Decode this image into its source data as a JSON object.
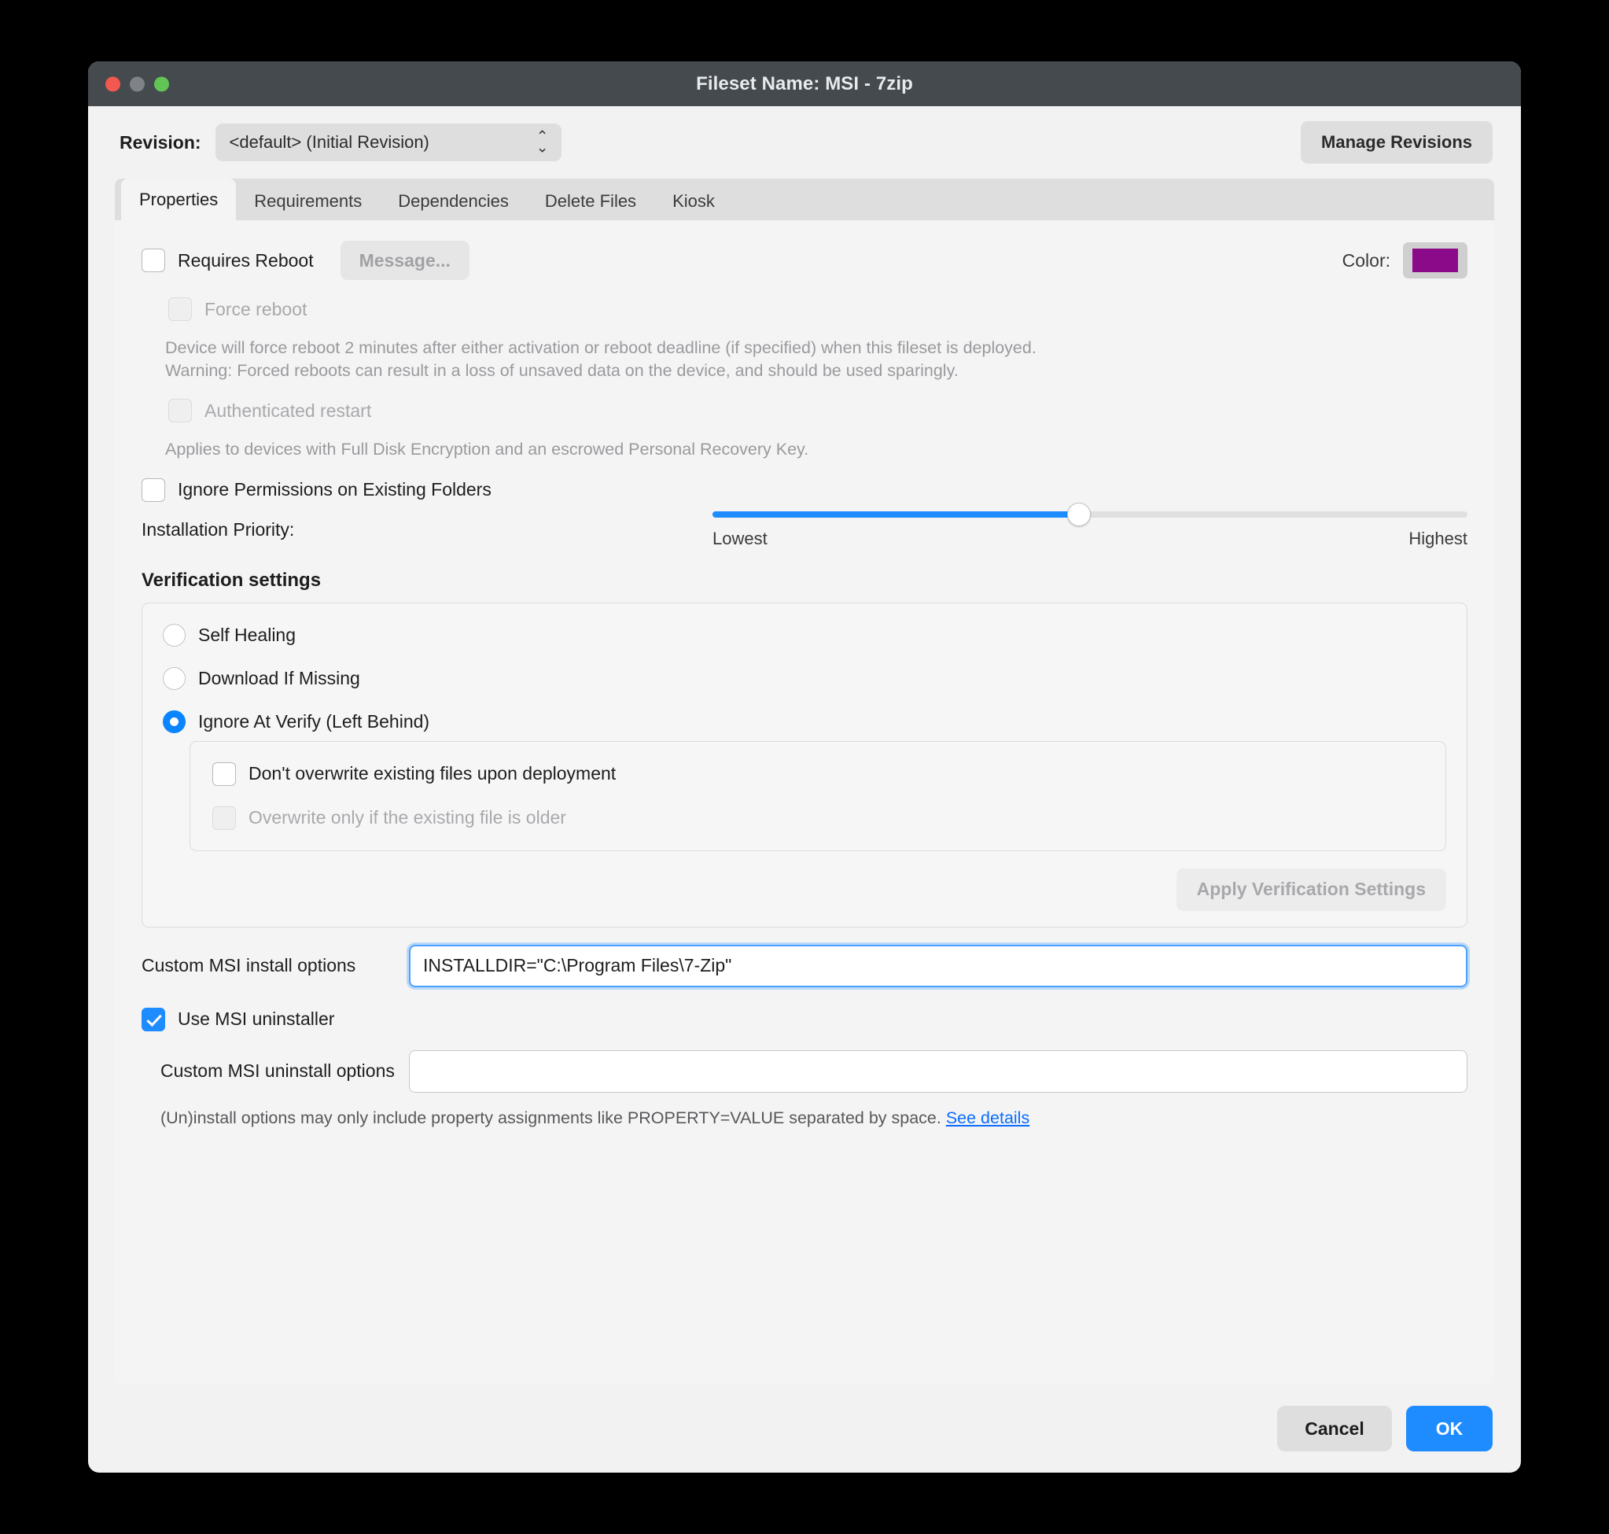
{
  "window": {
    "title": "Fileset Name: MSI - 7zip",
    "traffic_lights": [
      "close",
      "minimize",
      "zoom"
    ]
  },
  "revision": {
    "label": "Revision:",
    "selected": "<default> (Initial Revision)",
    "manage_button": "Manage Revisions"
  },
  "tabs": [
    {
      "label": "Properties",
      "active": true
    },
    {
      "label": "Requirements",
      "active": false
    },
    {
      "label": "Dependencies",
      "active": false
    },
    {
      "label": "Delete Files",
      "active": false
    },
    {
      "label": "Kiosk",
      "active": false
    }
  ],
  "properties": {
    "requires_reboot": {
      "label": "Requires Reboot",
      "checked": false,
      "message_button": "Message..."
    },
    "color": {
      "caption": "Color:",
      "value": "#8a0a8a"
    },
    "force_reboot": {
      "label": "Force reboot",
      "checked": false,
      "enabled": false
    },
    "force_reboot_hint_line1": "Device will force reboot 2 minutes after either activation or reboot deadline (if specified) when this fileset is deployed.",
    "force_reboot_hint_line2": "Warning: Forced reboots can result in a loss of unsaved data on the device, and should be used sparingly.",
    "authenticated_restart": {
      "label": "Authenticated restart",
      "checked": false,
      "enabled": false
    },
    "authenticated_restart_hint": "Applies to devices with Full Disk Encryption and an escrowed Personal Recovery Key.",
    "ignore_permissions": {
      "label": "Ignore Permissions on Existing Folders",
      "checked": false
    },
    "installation_priority": {
      "label": "Installation Priority:",
      "min_label": "Lowest",
      "max_label": "Highest",
      "value_percent": 48.5
    }
  },
  "verification": {
    "title": "Verification settings",
    "options": [
      {
        "label": "Self Healing",
        "selected": false
      },
      {
        "label": "Download If Missing",
        "selected": false
      },
      {
        "label": "Ignore At Verify (Left Behind)",
        "selected": true
      }
    ],
    "overwrite_options": [
      {
        "label": "Don't overwrite existing files upon deployment",
        "checked": false,
        "enabled": true
      },
      {
        "label": "Overwrite only if the existing file is older",
        "checked": false,
        "enabled": false
      }
    ],
    "apply_button": "Apply Verification Settings"
  },
  "msi": {
    "install_options_label": "Custom MSI install options",
    "install_options_value": "INSTALLDIR=\"C:\\Program Files\\7-Zip\"",
    "install_options_placeholder": "",
    "use_uninstaller": {
      "label": "Use MSI uninstaller",
      "checked": true
    },
    "uninstall_options_label": "Custom MSI uninstall options",
    "uninstall_options_value": "",
    "uninstall_options_placeholder": "",
    "footnote_text": "(Un)install options may only include property assignments like PROPERTY=VALUE separated by space. ",
    "footnote_link": "See details"
  },
  "footer": {
    "cancel": "Cancel",
    "ok": "OK"
  }
}
